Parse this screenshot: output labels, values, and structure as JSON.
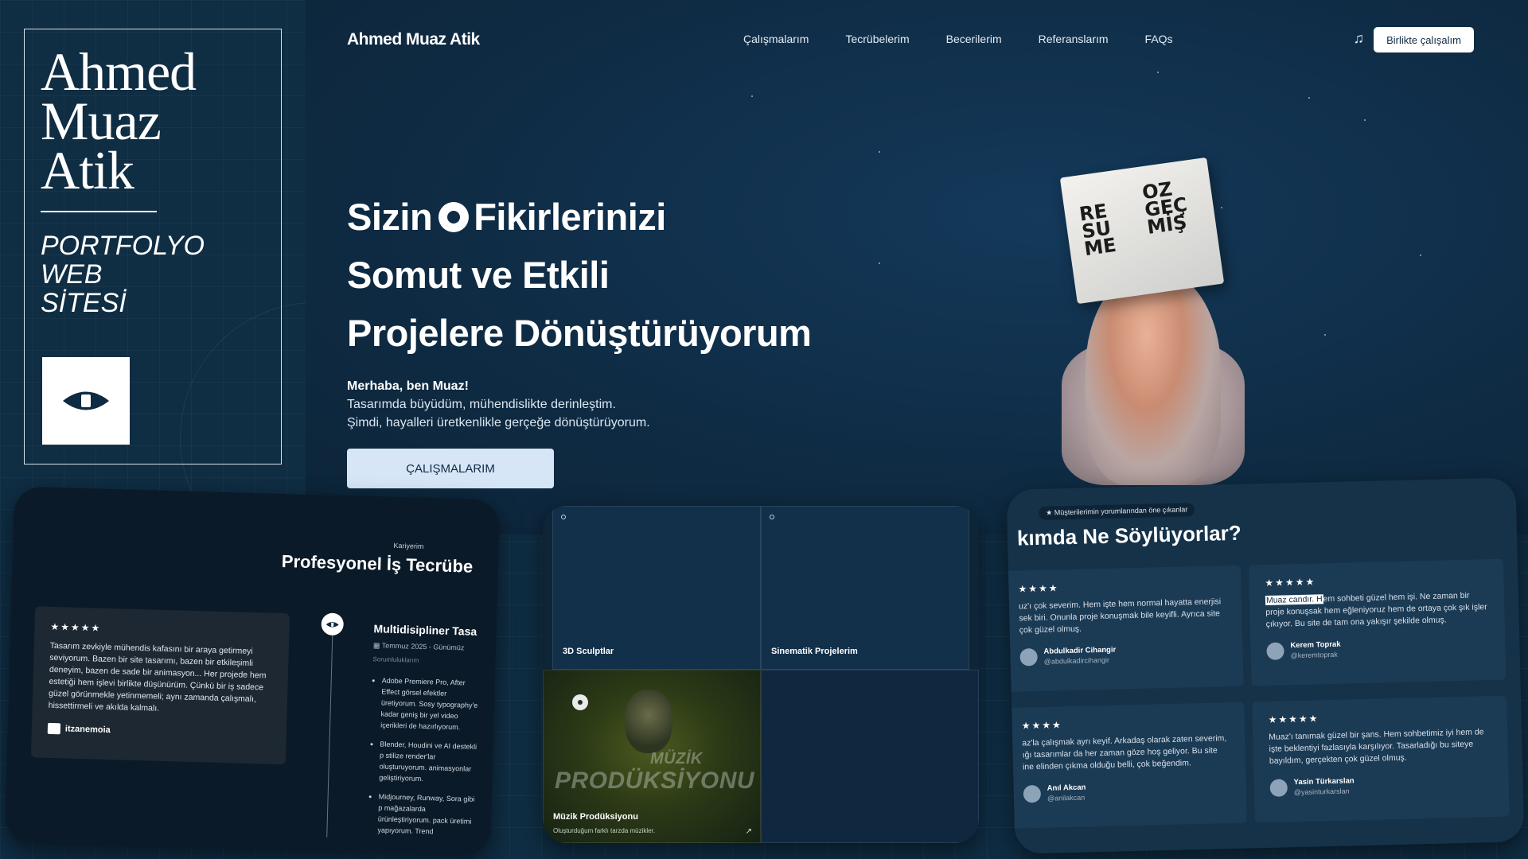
{
  "title_card": {
    "name_lines": [
      "Ahmed",
      "Muaz",
      "Atik"
    ],
    "subtitle_lines": [
      "PORTFOLYO",
      "WEB",
      "SİTESİ"
    ],
    "logo_icon": "eye-icon"
  },
  "nav": {
    "brand": "Ahmed Muaz Atik",
    "links": [
      "Çalışmalarım",
      "Tecrübelerim",
      "Becerilerim",
      "Referanslarım",
      "FAQs"
    ],
    "music_icon": "music-note-icon",
    "cta": "Birlikte çalışalım"
  },
  "hero": {
    "headline_1a": "Sizin",
    "headline_1b": "Fikirlerinizi",
    "headline_2": "Somut ve Etkili",
    "headline_3": "Projelere Dönüştürüyorum",
    "greeting": "Merhaba, ben Muaz!",
    "intro_1": "Tasarımda büyüdüm, mühendislikte derinleştim.",
    "intro_2": "Şimdi, hayalleri üretkenlikle gerçeğe dönüştürüyorum.",
    "cta": "ÇALIŞMALARIM",
    "figure_words_left": [
      "RE",
      "SU",
      "ME"
    ],
    "figure_words_right": [
      "OZ",
      "GEÇ",
      "MİŞ"
    ]
  },
  "experience": {
    "tag": "Kariyerim",
    "title": "Profesyonel İş Tecrübe",
    "quote_stars": "★★★★★",
    "quote": "Tasarım zevkiyle mühendis kafasını bir araya getirmeyi seviyorum. Bazen bir site tasarımı, bazen bir etkileşimli deneyim, bazen de sade bir animasyon... Her projede hem estetiği hem işlevi birlikte düşünürüm. Çünkü bir iş sadece güzel görünmekle yetinmemeli; aynı zamanda çalışmalı, hissettirmeli ve akılda kalmalı.",
    "quote_author": "itzanemoia",
    "role_title": "Multidisipliner Tasa",
    "role_date": "Temmuz 2025 - Günümüz",
    "role_sub": "Sorumluluklarım",
    "bullets": [
      "Adobe Premiere Pro, After Effect görsel efektler üretiyorum. Sosy typography'e kadar geniş bir yel video içerikleri de hazırlıyorum.",
      "Blender, Houdini ve AI destekli p stilize render'lar oluşturuyorum. animasyonlar geliştiriyorum.",
      "Midjourney, Runway, Sora gibi p mağazalarda ürünleştiriyorum. pack üretimi yapıyorum. Trend"
    ]
  },
  "projects": {
    "cells": [
      "3D Sculptlar",
      "Sinematik Projelerim"
    ],
    "music_label": "Müzik Prodüksiyonu",
    "music_sub": "Oluşturduğum farklı tarzda müzikler.",
    "music_watermark_top": "MÜZİK",
    "music_watermark": "PRODÜKSİYONU"
  },
  "reviews": {
    "tag": "★ Müşterilerimin yorumlarından öne çıkanlar",
    "title": "kımda Ne Söylüyorlar?",
    "items": [
      {
        "stars": "★★★★",
        "text": "uz'ı çok severim. Hem işte hem normal hayatta enerjisi sek biri. Onunla proje konuşmak bile keyifli. Ayrıca site çok güzel olmuş.",
        "name": "Abdulkadir Cihangir",
        "handle": "@abdulkadircihangir"
      },
      {
        "stars": "★★★★★",
        "highlight": "Muaz candır. H",
        "text": "em sohbeti güzel hem işi. Ne zaman bir proje konuşsak hem eğleniyoruz hem de ortaya çok şık işler çıkıyor. Bu site de tam ona yakışır şekilde olmuş.",
        "name": "Kerem Toprak",
        "handle": "@keremtoprak"
      },
      {
        "stars": "★★★★",
        "text": "az'la çalışmak ayrı keyif. Arkadaş olarak zaten severim, ığı tasarımlar da her zaman göze hoş geliyor. Bu site ine elinden çıkma olduğu belli, çok beğendim.",
        "name": "Anıl Akcan",
        "handle": "@anilakcan"
      },
      {
        "stars": "★★★★★",
        "text": "Muaz'ı tanımak güzel bir şans. Hem sohbetimiz iyi hem de işte beklentiyi fazlasıyla karşılıyor. Tasarladığı bu siteye bayıldım, gerçekten çok güzel olmuş.",
        "name": "Yasin Türkarslan",
        "handle": "@yasinturkarslan"
      }
    ]
  }
}
